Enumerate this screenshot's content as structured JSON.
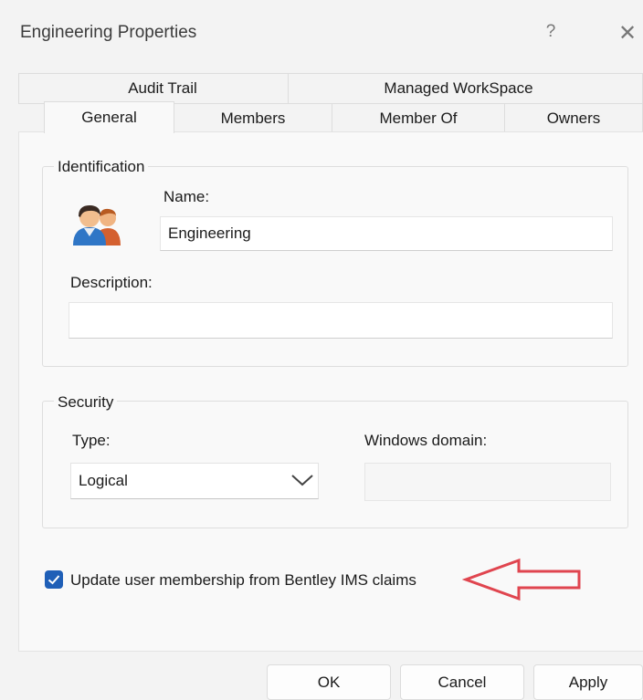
{
  "window": {
    "title": "Engineering Properties",
    "help_glyph": "?",
    "close_glyph": "✕"
  },
  "tabs": {
    "row1": [
      {
        "label": "Audit Trail"
      },
      {
        "label": "Managed WorkSpace"
      }
    ],
    "row2": [
      {
        "label": "General",
        "selected": true
      },
      {
        "label": "Members"
      },
      {
        "label": "Member Of"
      },
      {
        "label": "Owners"
      }
    ]
  },
  "identification": {
    "group_label": "Identification",
    "icon": "users-icon",
    "name_label": "Name:",
    "name_value": "Engineering",
    "description_label": "Description:",
    "description_value": ""
  },
  "security": {
    "group_label": "Security",
    "type_label": "Type:",
    "type_value": "Logical",
    "windows_domain_label": "Windows domain:",
    "windows_domain_value": ""
  },
  "options": {
    "update_membership_label": "Update user membership from Bentley IMS claims",
    "update_membership_checked": true
  },
  "annotation": {
    "arrow_color": "#e0454f"
  },
  "buttons": {
    "ok": "OK",
    "cancel": "Cancel",
    "apply": "Apply"
  },
  "colors": {
    "accent": "#1f5fb7"
  }
}
